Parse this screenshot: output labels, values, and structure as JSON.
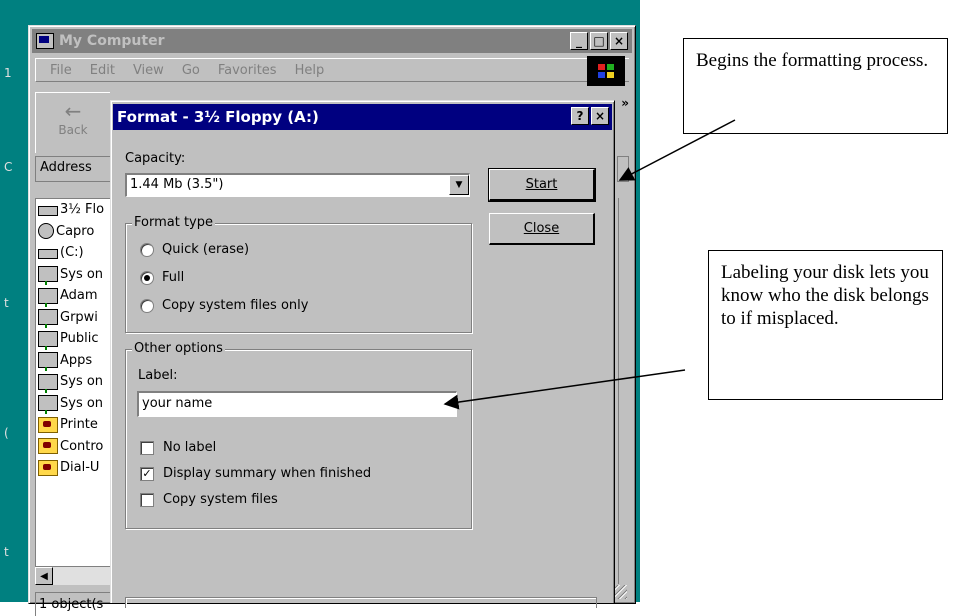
{
  "desktop": {
    "edge_chars": [
      "1",
      "C",
      "t",
      "(",
      "t"
    ]
  },
  "my_computer": {
    "title": "My Computer",
    "window_buttons": {
      "minimize": "_",
      "maximize": "□",
      "close": "×"
    },
    "menu": [
      "File",
      "Edit",
      "View",
      "Go",
      "Favorites",
      "Help"
    ],
    "toolbar": {
      "back_label": "Back"
    },
    "chevron": "»",
    "address_label": "Address",
    "items": [
      {
        "label": "3½ Flo",
        "icon": "floppy-drive-icon"
      },
      {
        "label": "Capro",
        "icon": "cd-drive-icon"
      },
      {
        "label": "(C:)",
        "icon": "hard-drive-icon"
      },
      {
        "label": "Sys on",
        "icon": "network-drive-icon"
      },
      {
        "label": "Adam",
        "icon": "network-drive-icon"
      },
      {
        "label": "Grpwi",
        "icon": "network-drive-icon"
      },
      {
        "label": "Public",
        "icon": "network-drive-icon"
      },
      {
        "label": "Apps",
        "icon": "network-drive-icon"
      },
      {
        "label": "Sys on",
        "icon": "network-drive-icon"
      },
      {
        "label": "Sys on",
        "icon": "network-drive-icon"
      },
      {
        "label": "Printe",
        "icon": "printers-folder-icon"
      },
      {
        "label": "Contro",
        "icon": "control-panel-folder-icon"
      },
      {
        "label": "Dial-U",
        "icon": "dialup-folder-icon"
      }
    ],
    "status_text": "1 object(s"
  },
  "format_dialog": {
    "title": "Format - 3½ Floppy (A:)",
    "help_button": "?",
    "close_x": "×",
    "capacity_label": "Capacity:",
    "capacity_value": "1.44 Mb (3.5\")",
    "start_button": "Start",
    "close_button": "Close",
    "format_type": {
      "title": "Format type",
      "options": [
        {
          "label": "Quick (erase)",
          "selected": false
        },
        {
          "label": "Full",
          "selected": true
        },
        {
          "label": "Copy system files only",
          "selected": false
        }
      ]
    },
    "other_options": {
      "title": "Other options",
      "label_caption": "Label:",
      "label_value": "your name",
      "checkboxes": [
        {
          "label": "No label",
          "checked": false
        },
        {
          "label": "Display summary when finished",
          "checked": true
        },
        {
          "label": "Copy system files",
          "checked": false
        }
      ]
    }
  },
  "callouts": {
    "start": "Begins the formatting process.",
    "label": "Labeling your disk lets you know who the disk belongs to if misplaced."
  }
}
